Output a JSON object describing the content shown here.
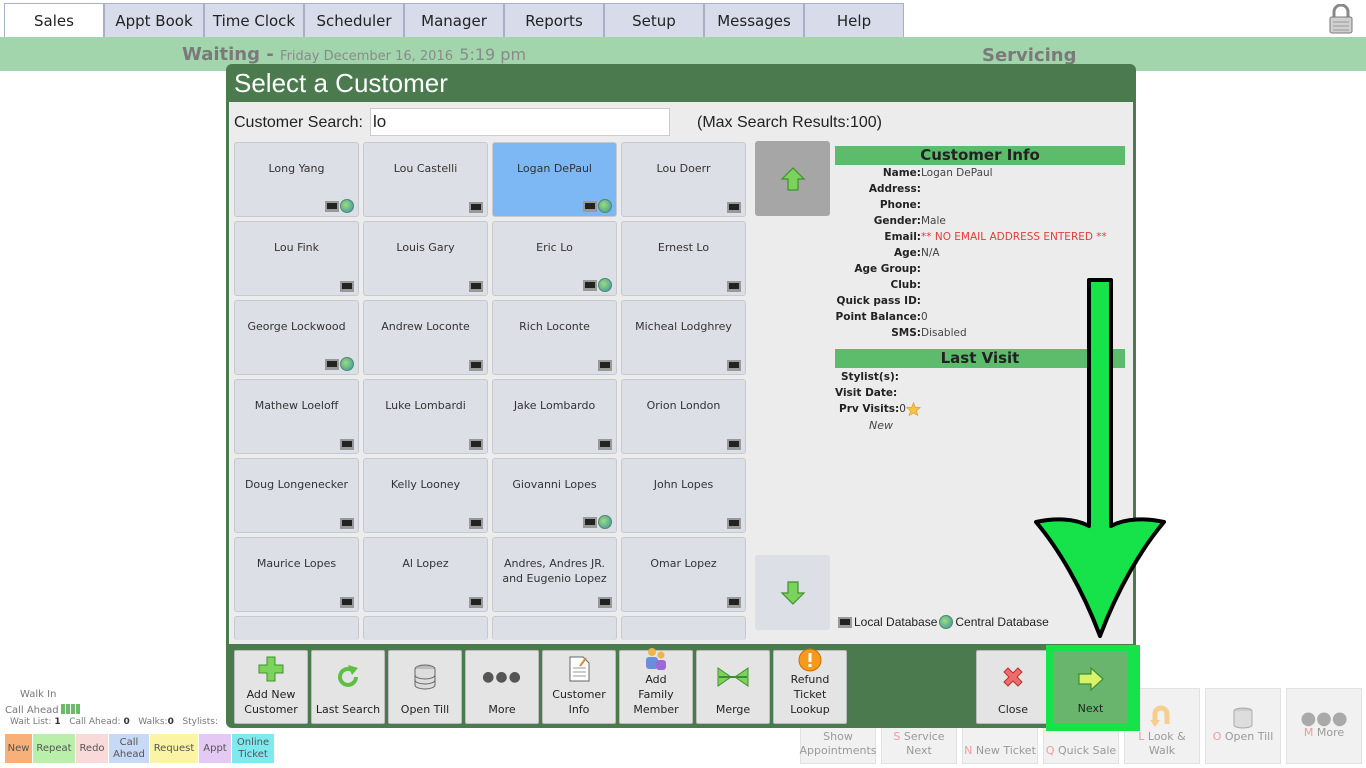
{
  "nav": {
    "tabs": [
      "Sales",
      "Appt Book",
      "Time Clock",
      "Scheduler",
      "Manager",
      "Reports",
      "Setup",
      "Messages",
      "Help"
    ]
  },
  "status_bar": {
    "waiting": "Waiting -",
    "date": "Friday December 16, 2016",
    "time": "5:19 pm",
    "servicing": "Servicing"
  },
  "modal": {
    "title": "Select a Customer",
    "search_label": "Customer Search:",
    "search_value": "lo",
    "max_results": "(Max Search Results:100)"
  },
  "customers": [
    {
      "name": "Long Yang",
      "central": true
    },
    {
      "name": "Lou Castelli",
      "central": false
    },
    {
      "name": "Logan DePaul",
      "central": true,
      "selected": true
    },
    {
      "name": "Lou Doerr",
      "central": false
    },
    {
      "name": "Lou Fink",
      "central": false
    },
    {
      "name": "Louis Gary",
      "central": false
    },
    {
      "name": "Eric Lo",
      "central": true
    },
    {
      "name": "Ernest Lo",
      "central": false
    },
    {
      "name": "George Lockwood",
      "central": true
    },
    {
      "name": "Andrew Loconte",
      "central": false
    },
    {
      "name": "Rich Loconte",
      "central": false
    },
    {
      "name": "Micheal Lodghrey",
      "central": false
    },
    {
      "name": "Mathew Loeloff",
      "central": false
    },
    {
      "name": "Luke Lombardi",
      "central": false
    },
    {
      "name": "Jake Lombardo",
      "central": false
    },
    {
      "name": "Orion London",
      "central": false
    },
    {
      "name": "Doug Longenecker",
      "central": false
    },
    {
      "name": "Kelly Looney",
      "central": false
    },
    {
      "name": "Giovanni Lopes",
      "central": true
    },
    {
      "name": "John Lopes",
      "central": false
    },
    {
      "name": "Maurice Lopes",
      "central": false
    },
    {
      "name": "Al Lopez",
      "central": false
    },
    {
      "name": "Andres, Andres JR. and Eugenio Lopez",
      "central": false
    },
    {
      "name": "Omar Lopez",
      "central": false
    }
  ],
  "customer_info": {
    "heading": "Customer Info",
    "fields": [
      {
        "key": "Name:",
        "value": "Logan DePaul"
      },
      {
        "key": "Address:",
        "value": ""
      },
      {
        "key": "Phone:",
        "value": ""
      },
      {
        "key": "Gender:",
        "value": "Male"
      },
      {
        "key": "Email:",
        "value": "** NO EMAIL ADDRESS ENTERED **",
        "warn": true
      },
      {
        "key": "Age:",
        "value": "N/A"
      },
      {
        "key": "Age Group:",
        "value": ""
      },
      {
        "key": "Club:",
        "value": ""
      },
      {
        "key": "Quick pass ID:",
        "value": ""
      },
      {
        "key": "Point Balance:",
        "value": "0"
      },
      {
        "key": "SMS:",
        "value": "Disabled"
      }
    ]
  },
  "last_visit": {
    "heading": "Last Visit",
    "stylists_label": "Stylist(s):",
    "visit_date_label": "Visit Date:",
    "prv_visits_label": "Prv Visits:",
    "prv_visits_value": "0",
    "new_label": "New"
  },
  "legend": {
    "local": "Local Database",
    "central": "Central Database"
  },
  "footer_buttons": [
    "Add New Customer",
    "Last Search",
    "Open Till",
    "More",
    "Customer Info",
    "Add Family Member",
    "Merge",
    "Refund Ticket Lookup"
  ],
  "close_label": "Close",
  "next_label": "Next",
  "bottom_left": {
    "walk_in": "Walk In",
    "call_ahead": "Call Ahead",
    "wait_list_label": "Wait List:",
    "wait_list_value": "1",
    "call_ahead_label": "Call Ahead:",
    "call_ahead_value": "0",
    "walks_label": "Walks:",
    "walks_value": "0",
    "stylists_label": "Stylists:",
    "chips": [
      {
        "label": "New",
        "color": "#f7b07a"
      },
      {
        "label": "Repeat",
        "color": "#b9efa8"
      },
      {
        "label": "Redo",
        "color": "#f8dada"
      },
      {
        "label": "Call Ahead",
        "color": "#c7d9f4"
      },
      {
        "label": "Request",
        "color": "#fbf4a5"
      },
      {
        "label": "Appt",
        "color": "#e3c9f4"
      },
      {
        "label": "Online Ticket",
        "color": "#7ee9ef"
      }
    ]
  },
  "bottom_right": [
    {
      "key": "",
      "label": "Show Appointments"
    },
    {
      "key": "S",
      "label": "Service Next"
    },
    {
      "key": "N",
      "label": "New Ticket"
    },
    {
      "key": "Q",
      "label": "Quick Sale"
    },
    {
      "key": "L",
      "label": "Look & Walk"
    },
    {
      "key": "O",
      "label": "Open Till"
    },
    {
      "key": "M",
      "label": "More"
    }
  ]
}
